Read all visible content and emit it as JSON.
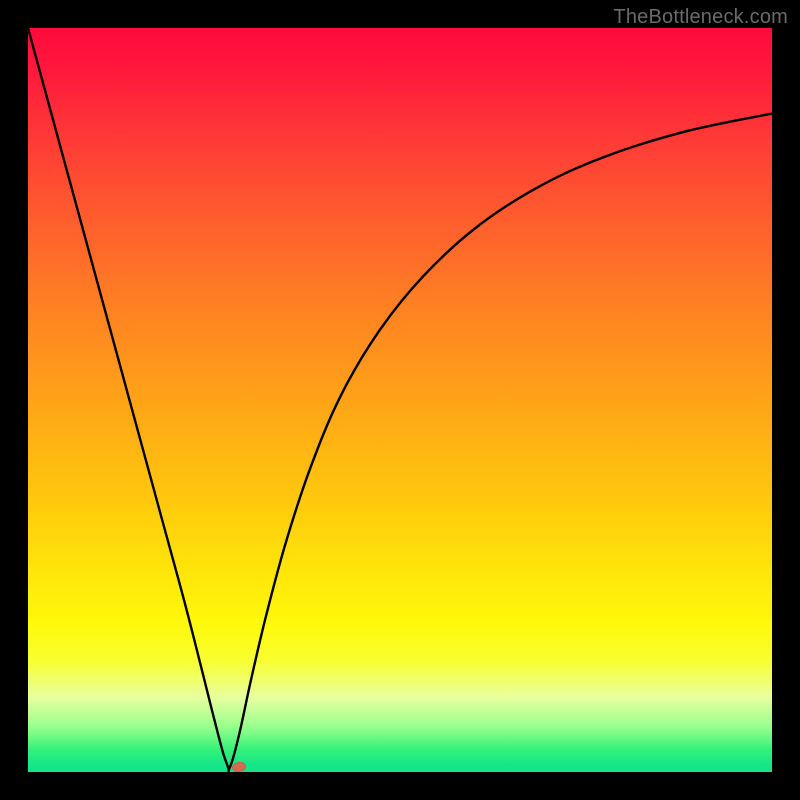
{
  "watermark": "TheBottleneck.com",
  "chart_data": {
    "type": "line",
    "title": "",
    "xlabel": "",
    "ylabel": "",
    "x_range": [
      0,
      100
    ],
    "y_range": [
      0,
      100
    ],
    "notch_x": 27,
    "marker": {
      "x": 28.3,
      "y": 0.7
    },
    "series": [
      {
        "name": "left-arm",
        "x": [
          0,
          3,
          6,
          9,
          12,
          15,
          18,
          21,
          23.3,
          24.8,
          25.7,
          26.3,
          26.8,
          27.0
        ],
        "y": [
          100,
          89,
          78,
          67,
          56,
          45,
          34,
          23,
          14,
          8,
          4.5,
          2.3,
          0.9,
          0.3
        ]
      },
      {
        "name": "right-arm",
        "x": [
          27.0,
          27.6,
          28.6,
          30.0,
          32.0,
          34.7,
          38.0,
          42.0,
          47.0,
          53.0,
          60.0,
          68.0,
          77.0,
          88.0,
          100.0
        ],
        "y": [
          0.3,
          2.0,
          6.0,
          12.5,
          21.0,
          31.0,
          41.0,
          50.5,
          59.0,
          66.5,
          73.0,
          78.3,
          82.5,
          86.0,
          88.5
        ]
      }
    ],
    "background_gradient_stops": [
      {
        "pos": 0,
        "color": "#ff0a3c"
      },
      {
        "pos": 15,
        "color": "#ff3a36"
      },
      {
        "pos": 38,
        "color": "#ff8222"
      },
      {
        "pos": 62,
        "color": "#ffc40e"
      },
      {
        "pos": 80,
        "color": "#fff90a"
      },
      {
        "pos": 94,
        "color": "#96ff8c"
      },
      {
        "pos": 100,
        "color": "#14e38a"
      }
    ]
  }
}
